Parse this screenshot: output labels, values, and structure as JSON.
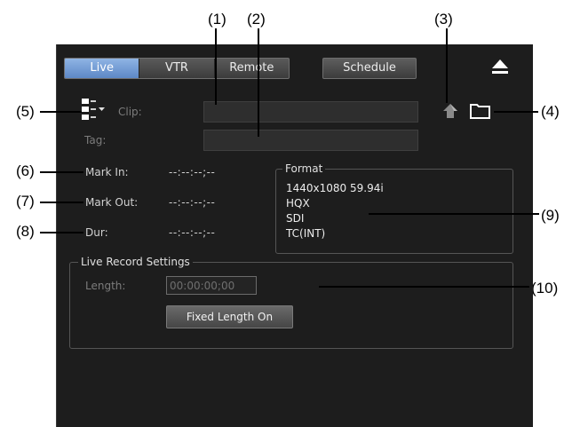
{
  "callouts": [
    "(1)",
    "(2)",
    "(3)",
    "(4)",
    "(5)",
    "(6)",
    "(7)",
    "(8)",
    "(9)",
    "(10)"
  ],
  "tabs": [
    "Live",
    "VTR",
    "Remote"
  ],
  "active_tab": "Live",
  "schedule_label": "Schedule",
  "clip_label": "Clip:",
  "tag_label": "Tag:",
  "marks": [
    {
      "label": "Mark In:",
      "value": "--:--:--;--"
    },
    {
      "label": "Mark Out:",
      "value": "--:--:--;--"
    },
    {
      "label": "Dur:",
      "value": "--:--:--;--"
    }
  ],
  "format": {
    "title": "Format",
    "lines": [
      "1440x1080 59.94i",
      "HQX",
      "SDI",
      "TC(INT)"
    ]
  },
  "live_record": {
    "title": "Live Record Settings",
    "length_label": "Length:",
    "length_value": "00:00:00;00",
    "fixed_button": "Fixed Length On"
  },
  "icons": [
    "eject-icon",
    "clip-list-icon",
    "upload-icon",
    "folder-icon"
  ],
  "colors": {
    "panel_bg": "#1d1d1d",
    "active_tab": "#6f96d2"
  }
}
